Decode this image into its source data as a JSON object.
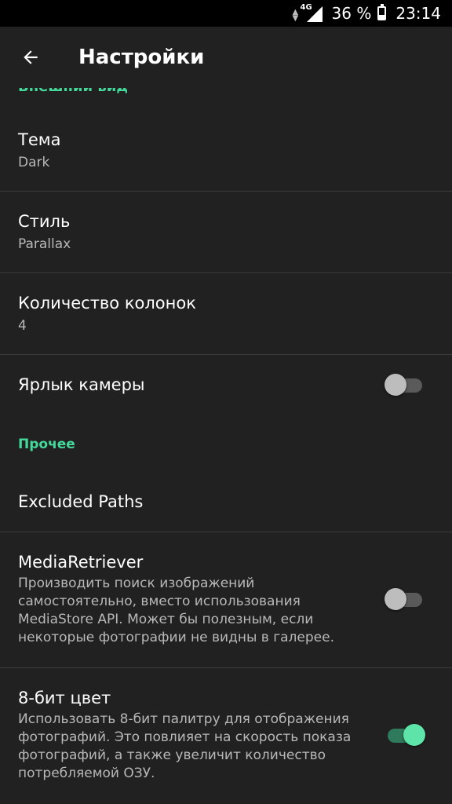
{
  "status_bar": {
    "network": "4G",
    "battery": "36 %",
    "time": "23:14"
  },
  "app_bar": {
    "title": "Настройки"
  },
  "sections": {
    "appearance_header": "Внешний вид",
    "other_header": "Прочее"
  },
  "items": {
    "theme": {
      "title": "Тема",
      "value": "Dark"
    },
    "style": {
      "title": "Стиль",
      "value": "Parallax"
    },
    "columns": {
      "title": "Количество колонок",
      "value": "4"
    },
    "camera_shortcut": {
      "title": "Ярлык камеры",
      "enabled": false
    },
    "excluded_paths": {
      "title": "Excluded Paths"
    },
    "media_retriever": {
      "title": "MediaRetriever",
      "description": "Производить поиск изображений самостоятельно, вместо использования MediaStore API. Может бы полезным, если некоторые фотографии не видны в галерее.",
      "enabled": false
    },
    "eight_bit_color": {
      "title": "8-бит цвет",
      "description": "Использовать 8-бит палитру для отображения фотографий. Это повлияет на скорость показа фотографий, а также увеличит количество потребляемой ОЗУ.",
      "enabled": true
    }
  },
  "colors": {
    "background": "#212121",
    "accent": "#44d99b",
    "divider": "#3a3a3a"
  }
}
